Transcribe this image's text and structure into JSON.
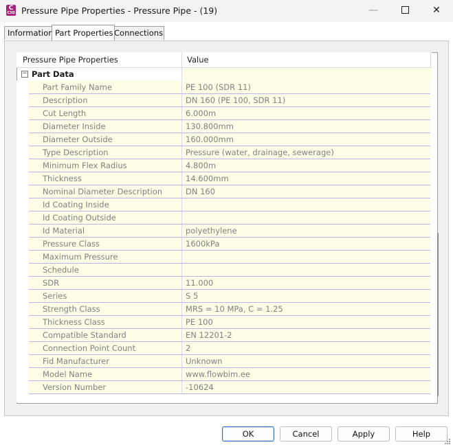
{
  "window": {
    "title": "Pressure Pipe Properties - Pressure Pipe - (19)",
    "icon_letter": "C",
    "icon_sub": "C3D",
    "min_icon": "minimize-icon",
    "max_icon": "maximize-icon",
    "close_icon": "close-icon",
    "min_glyph": "—",
    "close_glyph": "✕"
  },
  "tabs": [
    {
      "label": "Information"
    },
    {
      "label": "Part Properties"
    },
    {
      "label": "Connections"
    }
  ],
  "grid": {
    "col_property": "Pressure Pipe Properties",
    "col_value": "Value",
    "group_label": "Part Data",
    "collapse_glyph": "−",
    "rows": [
      {
        "name": "Part Family Name",
        "value": "PE 100 (SDR 11)"
      },
      {
        "name": "Description",
        "value": "DN 160 (PE 100, SDR 11)"
      },
      {
        "name": "Cut Length",
        "value": "6.000m"
      },
      {
        "name": "Diameter Inside",
        "value": "130.800mm"
      },
      {
        "name": "Diameter Outside",
        "value": "160.000mm"
      },
      {
        "name": "Type Description",
        "value": "Pressure (water, drainage, sewerage)"
      },
      {
        "name": "Minimum Flex Radius",
        "value": "4.800m"
      },
      {
        "name": "Thickness",
        "value": "14.600mm"
      },
      {
        "name": "Nominal Diameter Description",
        "value": "DN 160"
      },
      {
        "name": "Id Coating Inside",
        "value": ""
      },
      {
        "name": "Id Coating Outside",
        "value": ""
      },
      {
        "name": "Id Material",
        "value": "polyethylene"
      },
      {
        "name": "Pressure Class",
        "value": "1600kPa"
      },
      {
        "name": "Maximum Pressure",
        "value": ""
      },
      {
        "name": "Schedule",
        "value": ""
      },
      {
        "name": "SDR",
        "value": "11.000"
      },
      {
        "name": "Series",
        "value": "S 5"
      },
      {
        "name": "Strength Class",
        "value": "MRS = 10 MPa, C = 1.25"
      },
      {
        "name": "Thickness Class",
        "value": "PE 100"
      },
      {
        "name": "Compatible Standard",
        "value": "EN 12201-2"
      },
      {
        "name": "Connection Point Count",
        "value": "2"
      },
      {
        "name": "Fid Manufacturer",
        "value": "Unknown"
      },
      {
        "name": "Model Name",
        "value": "www.flowbim.ee"
      },
      {
        "name": "Version Number",
        "value": "-10624"
      }
    ]
  },
  "buttons": {
    "ok": "OK",
    "cancel": "Cancel",
    "apply": "Apply",
    "help": "Help"
  },
  "colors": {
    "row_background": "#fefde6",
    "row_separator": "#b9b5e8",
    "default_button_border": "#2a6ec5",
    "app_icon": "#a8247a"
  }
}
